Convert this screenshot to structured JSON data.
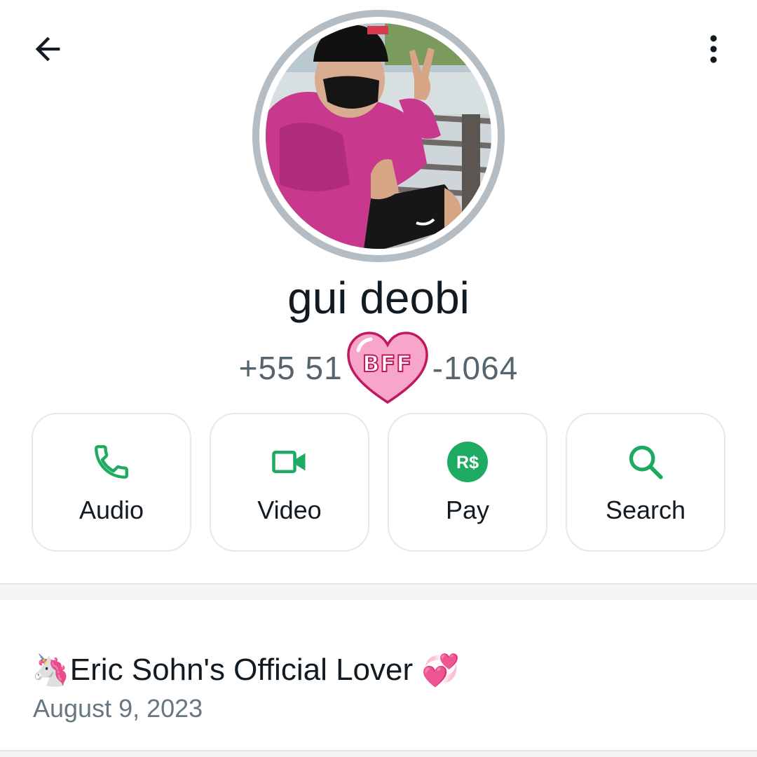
{
  "header": {
    "back_icon": "arrow-left-icon",
    "menu_icon": "more-vertical-icon"
  },
  "contact": {
    "name": "gui deobi",
    "phone_prefix": "+55 51",
    "phone_sticker": "BFF",
    "phone_suffix": "-1064"
  },
  "actions": [
    {
      "label": "Audio",
      "icon": "phone-icon"
    },
    {
      "label": "Video",
      "icon": "video-camera-icon"
    },
    {
      "label": "Pay",
      "icon": "pay-icon",
      "icon_text": "R$"
    },
    {
      "label": "Search",
      "icon": "search-icon"
    }
  ],
  "about": {
    "text": "Eric Sohn's Official Lover",
    "leading_emoji": "🦄",
    "trailing_emoji": "💞",
    "date": "August 9, 2023"
  },
  "colors": {
    "accent": "#1daa61",
    "text_primary": "#111b21",
    "text_secondary": "#54656f",
    "avatar_ring": "#b4bcc4",
    "sticker_pink": "#f7a6c9"
  }
}
